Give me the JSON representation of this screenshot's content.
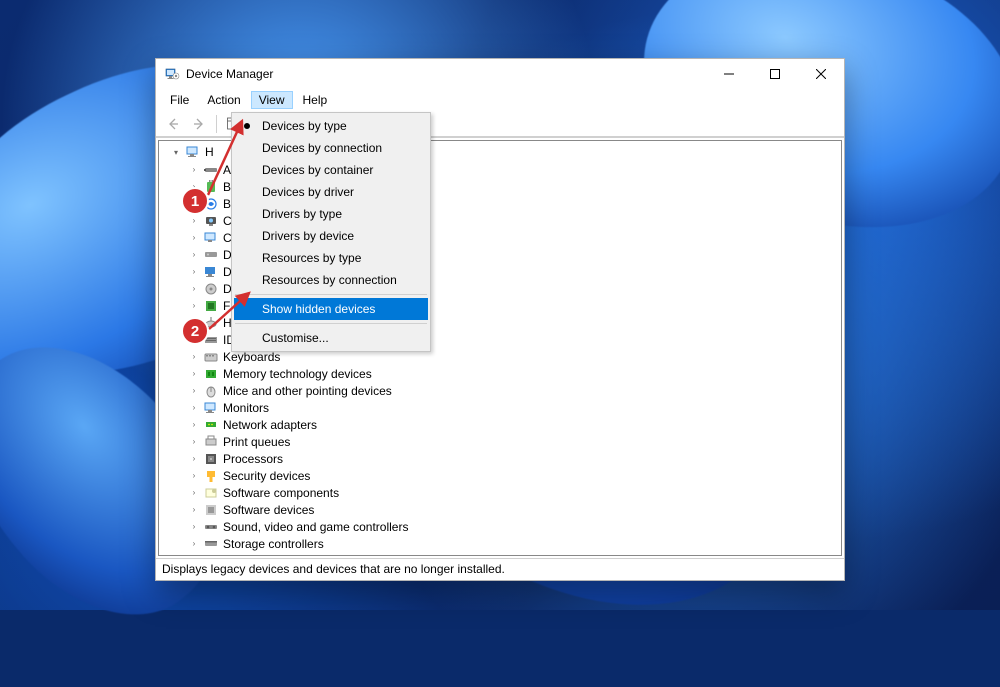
{
  "window": {
    "title": "Device Manager"
  },
  "menubar": {
    "items": [
      "File",
      "Action",
      "View",
      "Help"
    ],
    "active_index": 2
  },
  "view_menu": {
    "options": [
      "Devices by type",
      "Devices by connection",
      "Devices by container",
      "Devices by driver",
      "Drivers by type",
      "Drivers by device",
      "Resources by type",
      "Resources by connection"
    ],
    "current_index": 0,
    "show_hidden": "Show hidden devices",
    "customise": "Customise..."
  },
  "tree": {
    "root_label": "H",
    "categories": [
      "Aud",
      "Batt",
      "Blue",
      "Cam",
      "Com",
      "Disk",
      "Disp",
      "DVD",
      "Firm",
      "Hun",
      "IDE A",
      "Keyboards",
      "Memory technology devices",
      "Mice and other pointing devices",
      "Monitors",
      "Network adapters",
      "Print queues",
      "Processors",
      "Security devices",
      "Software components",
      "Software devices",
      "Sound, video and game controllers",
      "Storage controllers"
    ]
  },
  "statusbar": {
    "text": "Displays legacy devices and devices that are no longer installed."
  },
  "annotations": {
    "badge1": "1",
    "badge2": "2"
  }
}
